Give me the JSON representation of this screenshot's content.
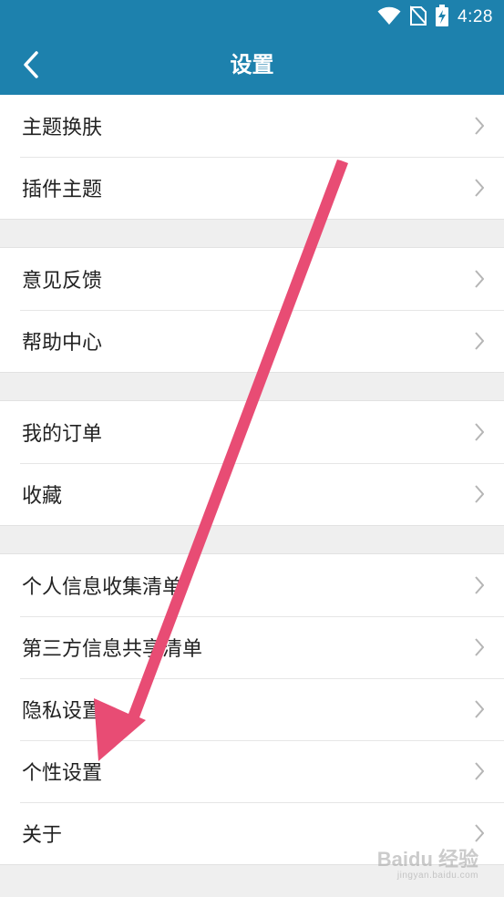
{
  "status_bar": {
    "time": "4:28"
  },
  "header": {
    "title": "设置"
  },
  "groups": [
    {
      "items": [
        {
          "label": "主题换肤"
        },
        {
          "label": "插件主题"
        }
      ]
    },
    {
      "items": [
        {
          "label": "意见反馈"
        },
        {
          "label": "帮助中心"
        }
      ]
    },
    {
      "items": [
        {
          "label": "我的订单"
        },
        {
          "label": "收藏"
        }
      ]
    },
    {
      "items": [
        {
          "label": "个人信息收集清单"
        },
        {
          "label": "第三方信息共享清单"
        },
        {
          "label": "隐私设置"
        },
        {
          "label": "个性设置"
        },
        {
          "label": "关于"
        }
      ]
    }
  ],
  "watermark": {
    "brand": "Baidu 经验",
    "url": "jingyan.baidu.com"
  },
  "colors": {
    "header": "#1d81ad",
    "arrow": "#e84c74",
    "background": "#efefef"
  }
}
